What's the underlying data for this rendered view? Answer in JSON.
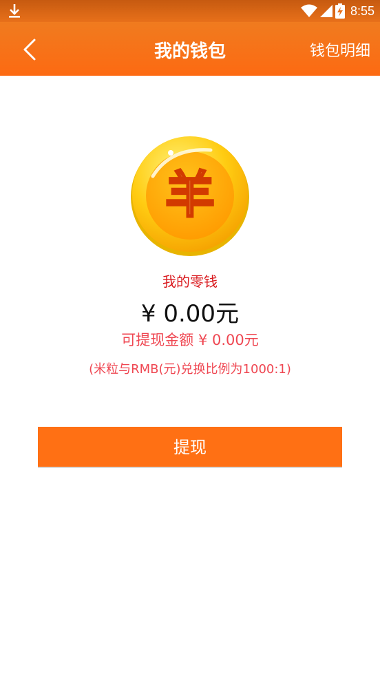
{
  "status_bar": {
    "time": "8:55"
  },
  "header": {
    "title": "我的钱包",
    "detail_link": "钱包明细"
  },
  "wallet": {
    "coin_symbol": "羊",
    "change_label": "我的零钱",
    "balance": "¥ 0.00元",
    "withdrawable": "可提现金额 ¥ 0.00元",
    "exchange_ratio": "(米粒与RMB(元)兑换比例为1000:1)"
  },
  "actions": {
    "withdraw_label": "提现"
  },
  "colors": {
    "primary": "#ff7014",
    "accent_red": "#d9181d",
    "pink_text": "#ef4752"
  }
}
